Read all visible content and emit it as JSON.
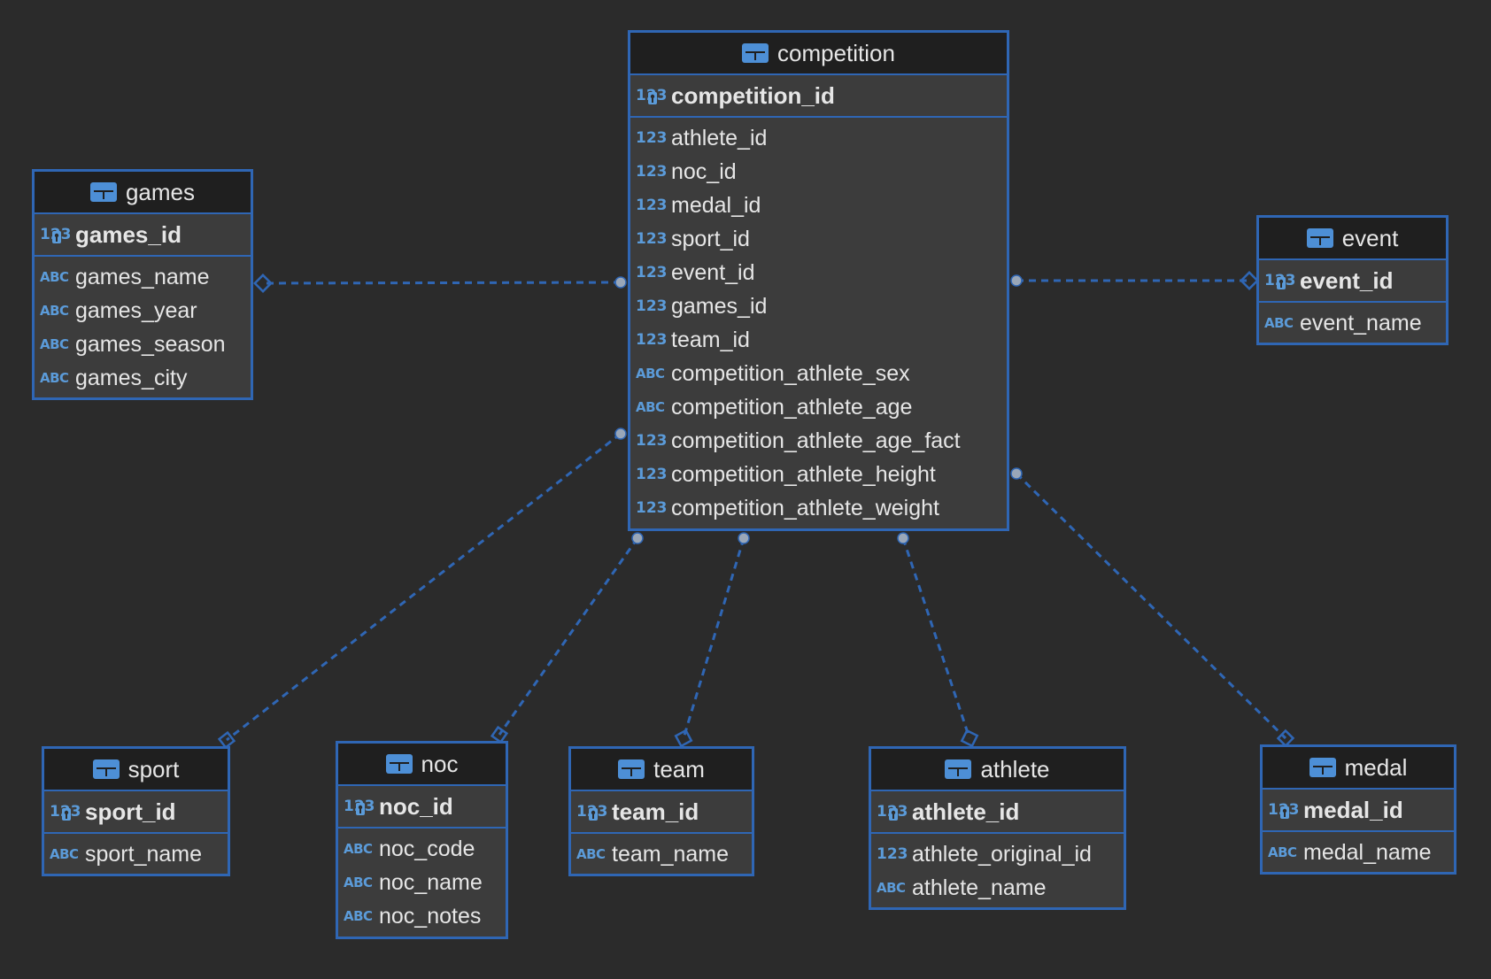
{
  "colors": {
    "background": "#2b2b2b",
    "accent": "#2f66b4",
    "header": "#1f1f1f",
    "body": "#3c3c3c"
  },
  "icons": {
    "table": "table-icon",
    "key": "primary-key-icon"
  },
  "tables": {
    "competition": {
      "name": "competition",
      "pk": {
        "type": "123",
        "name": "competition_id"
      },
      "fields": [
        {
          "type": "123",
          "name": "athlete_id"
        },
        {
          "type": "123",
          "name": "noc_id"
        },
        {
          "type": "123",
          "name": "medal_id"
        },
        {
          "type": "123",
          "name": "sport_id"
        },
        {
          "type": "123",
          "name": "event_id"
        },
        {
          "type": "123",
          "name": "games_id"
        },
        {
          "type": "123",
          "name": "team_id"
        },
        {
          "type": "ABC",
          "name": "competition_athlete_sex"
        },
        {
          "type": "ABC",
          "name": "competition_athlete_age"
        },
        {
          "type": "123",
          "name": "competition_athlete_age_fact"
        },
        {
          "type": "123",
          "name": "competition_athlete_height"
        },
        {
          "type": "123",
          "name": "competition_athlete_weight"
        }
      ]
    },
    "games": {
      "name": "games",
      "pk": {
        "type": "123",
        "name": "games_id"
      },
      "fields": [
        {
          "type": "ABC",
          "name": "games_name"
        },
        {
          "type": "ABC",
          "name": "games_year"
        },
        {
          "type": "ABC",
          "name": "games_season"
        },
        {
          "type": "ABC",
          "name": "games_city"
        }
      ]
    },
    "event": {
      "name": "event",
      "pk": {
        "type": "123",
        "name": "event_id"
      },
      "fields": [
        {
          "type": "ABC",
          "name": "event_name"
        }
      ]
    },
    "sport": {
      "name": "sport",
      "pk": {
        "type": "123",
        "name": "sport_id"
      },
      "fields": [
        {
          "type": "ABC",
          "name": "sport_name"
        }
      ]
    },
    "noc": {
      "name": "noc",
      "pk": {
        "type": "123",
        "name": "noc_id"
      },
      "fields": [
        {
          "type": "ABC",
          "name": "noc_code"
        },
        {
          "type": "ABC",
          "name": "noc_name"
        },
        {
          "type": "ABC",
          "name": "noc_notes"
        }
      ]
    },
    "team": {
      "name": "team",
      "pk": {
        "type": "123",
        "name": "team_id"
      },
      "fields": [
        {
          "type": "ABC",
          "name": "team_name"
        }
      ]
    },
    "athlete": {
      "name": "athlete",
      "pk": {
        "type": "123",
        "name": "athlete_id"
      },
      "fields": [
        {
          "type": "123",
          "name": "athlete_original_id"
        },
        {
          "type": "ABC",
          "name": "athlete_name"
        }
      ]
    },
    "medal": {
      "name": "medal",
      "pk": {
        "type": "123",
        "name": "medal_id"
      },
      "fields": [
        {
          "type": "ABC",
          "name": "medal_name"
        }
      ]
    }
  },
  "relationships": [
    {
      "from": "competition",
      "to": "games"
    },
    {
      "from": "competition",
      "to": "event"
    },
    {
      "from": "competition",
      "to": "sport"
    },
    {
      "from": "competition",
      "to": "noc"
    },
    {
      "from": "competition",
      "to": "team"
    },
    {
      "from": "competition",
      "to": "athlete"
    },
    {
      "from": "competition",
      "to": "medal"
    }
  ]
}
